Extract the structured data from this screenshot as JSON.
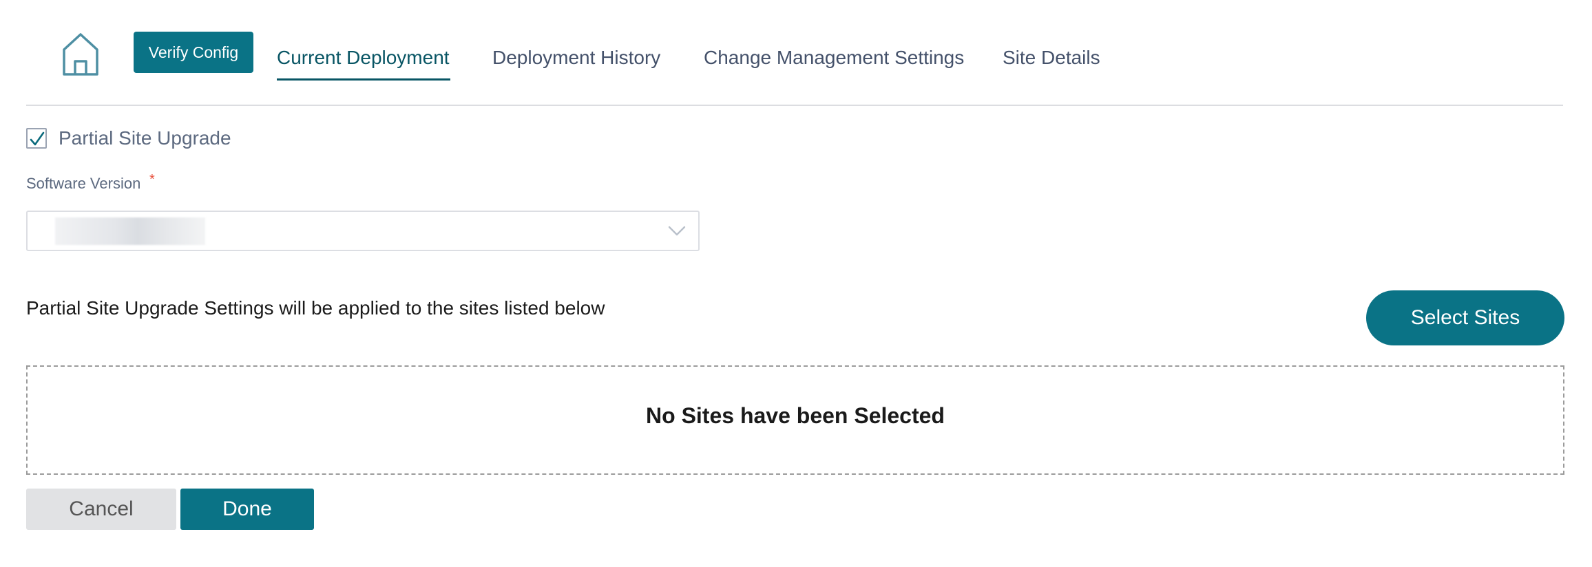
{
  "header": {
    "home_icon": "home-icon",
    "verify_config_label": "Verify Config",
    "tabs": [
      {
        "label": "Current Deployment",
        "active": true
      },
      {
        "label": "Deployment History",
        "active": false
      },
      {
        "label": "Change Management Settings",
        "active": false
      },
      {
        "label": "Site Details",
        "active": false
      }
    ]
  },
  "form": {
    "partial_site_upgrade": {
      "label": "Partial Site Upgrade",
      "checked": true
    },
    "software_version": {
      "label": "Software Version",
      "required_marker": "*",
      "value": "(redacted)",
      "icon": "chevron-down-icon"
    },
    "info_text": "Partial Site Upgrade Settings will be applied to the sites listed below",
    "select_sites_label": "Select Sites",
    "empty_state": "No Sites have been Selected"
  },
  "footer": {
    "cancel_label": "Cancel",
    "done_label": "Done"
  },
  "colors": {
    "primary": "#0a7386",
    "active_tab": "#085564",
    "tab_text": "#44516a",
    "required": "#e8533f",
    "cancel_bg": "#e1e2e4"
  }
}
